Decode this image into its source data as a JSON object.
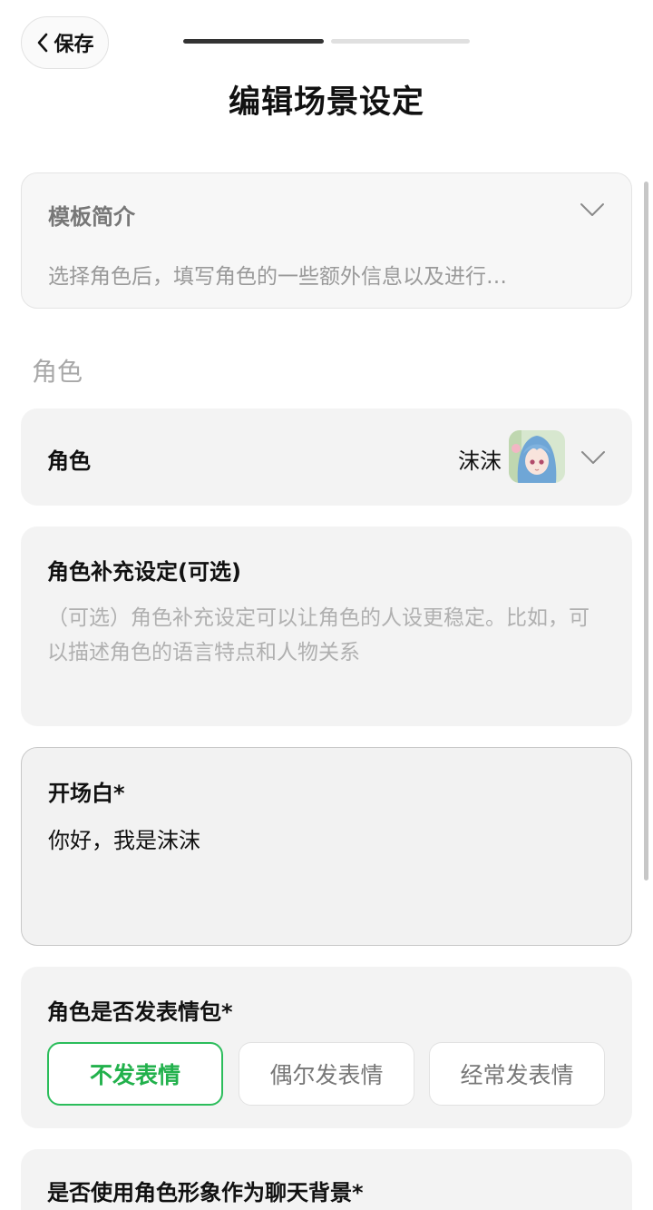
{
  "header": {
    "back_label": "保存",
    "title": "编辑场景设定"
  },
  "template": {
    "label": "模板简介",
    "description": "选择角色后，填写角色的一些额外信息以及进行…"
  },
  "section_heading": "角色",
  "role": {
    "label": "角色",
    "value": "沫沫"
  },
  "extra_setting": {
    "label": "角色补充设定(可选)",
    "placeholder": "（可选）角色补充设定可以让角色的人设更稳定。比如，可以描述角色的语言特点和人物关系"
  },
  "opening": {
    "label": "开场白*",
    "value": "你好，我是沫沫"
  },
  "sticker": {
    "label": "角色是否发表情包*",
    "options": [
      "不发表情",
      "偶尔发表情",
      "经常发表情"
    ],
    "selected": "不发表情"
  },
  "background": {
    "label": "是否使用角色形象作为聊天背景*"
  },
  "colors": {
    "accent": "#22b14c",
    "progress_done": "#333333",
    "progress_todo": "#e0e0e0"
  }
}
